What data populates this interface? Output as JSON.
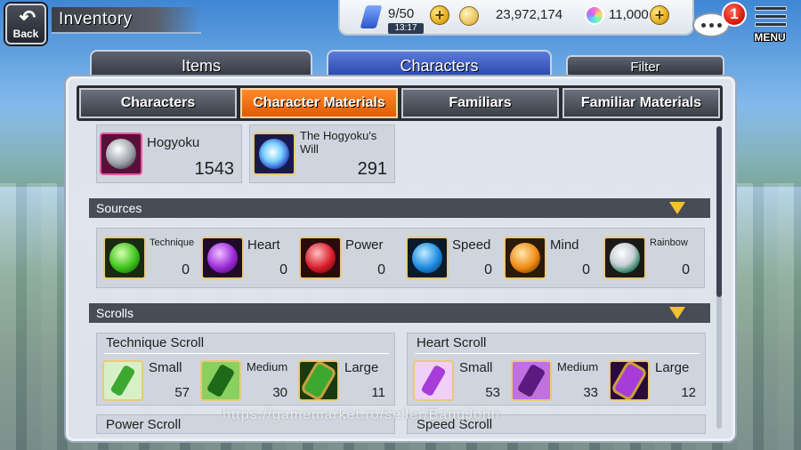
{
  "header": {
    "back_label": "Back",
    "title": "Inventory",
    "stamina": "9/50",
    "stamina_timer": "13:17",
    "gold": "23,972,174",
    "gems": "11,000",
    "notification_count": "1",
    "menu_label": "MENU"
  },
  "main_tabs": {
    "items_label": "Items",
    "characters_label": "Characters",
    "filter_label": "Filter"
  },
  "sub_tabs": [
    {
      "label": "Characters"
    },
    {
      "label": "Character Materials"
    },
    {
      "label": "Familiars"
    },
    {
      "label": "Familiar Materials"
    }
  ],
  "materials": [
    {
      "name": "Hogyoku",
      "count": "1543"
    },
    {
      "name": "The Hogyoku's Will",
      "count": "291"
    }
  ],
  "sources": {
    "title": "Sources",
    "items": [
      {
        "name": "Technique",
        "count": "0",
        "color": "#3cc41c"
      },
      {
        "name": "Heart",
        "count": "0",
        "color": "#9a2ad8"
      },
      {
        "name": "Power",
        "count": "0",
        "color": "#d81c2a"
      },
      {
        "name": "Speed",
        "count": "0",
        "color": "#1c8ae0"
      },
      {
        "name": "Mind",
        "count": "0",
        "color": "#f08a12"
      },
      {
        "name": "Rainbow",
        "count": "0",
        "color": "#e8e8e8"
      }
    ]
  },
  "scrolls": {
    "title": "Scrolls",
    "groups": [
      {
        "title": "Technique Scroll",
        "color": "#3ca830",
        "items": [
          {
            "size": "Small",
            "count": "57"
          },
          {
            "size": "Medium",
            "count": "30"
          },
          {
            "size": "Large",
            "count": "11"
          }
        ]
      },
      {
        "title": "Heart Scroll",
        "color": "#a83cd8",
        "items": [
          {
            "size": "Small",
            "count": "53"
          },
          {
            "size": "Medium",
            "count": "33"
          },
          {
            "size": "Large",
            "count": "12"
          }
        ]
      },
      {
        "title": "Power Scroll"
      },
      {
        "title": "Speed Scroll"
      }
    ]
  },
  "watermark": "https://gamemarket.ro/seller/BangJohn",
  "colors": {
    "active_tab": "#f07a1a",
    "characters_tab": "#3a5bc8",
    "section_bar": "#474c56"
  }
}
